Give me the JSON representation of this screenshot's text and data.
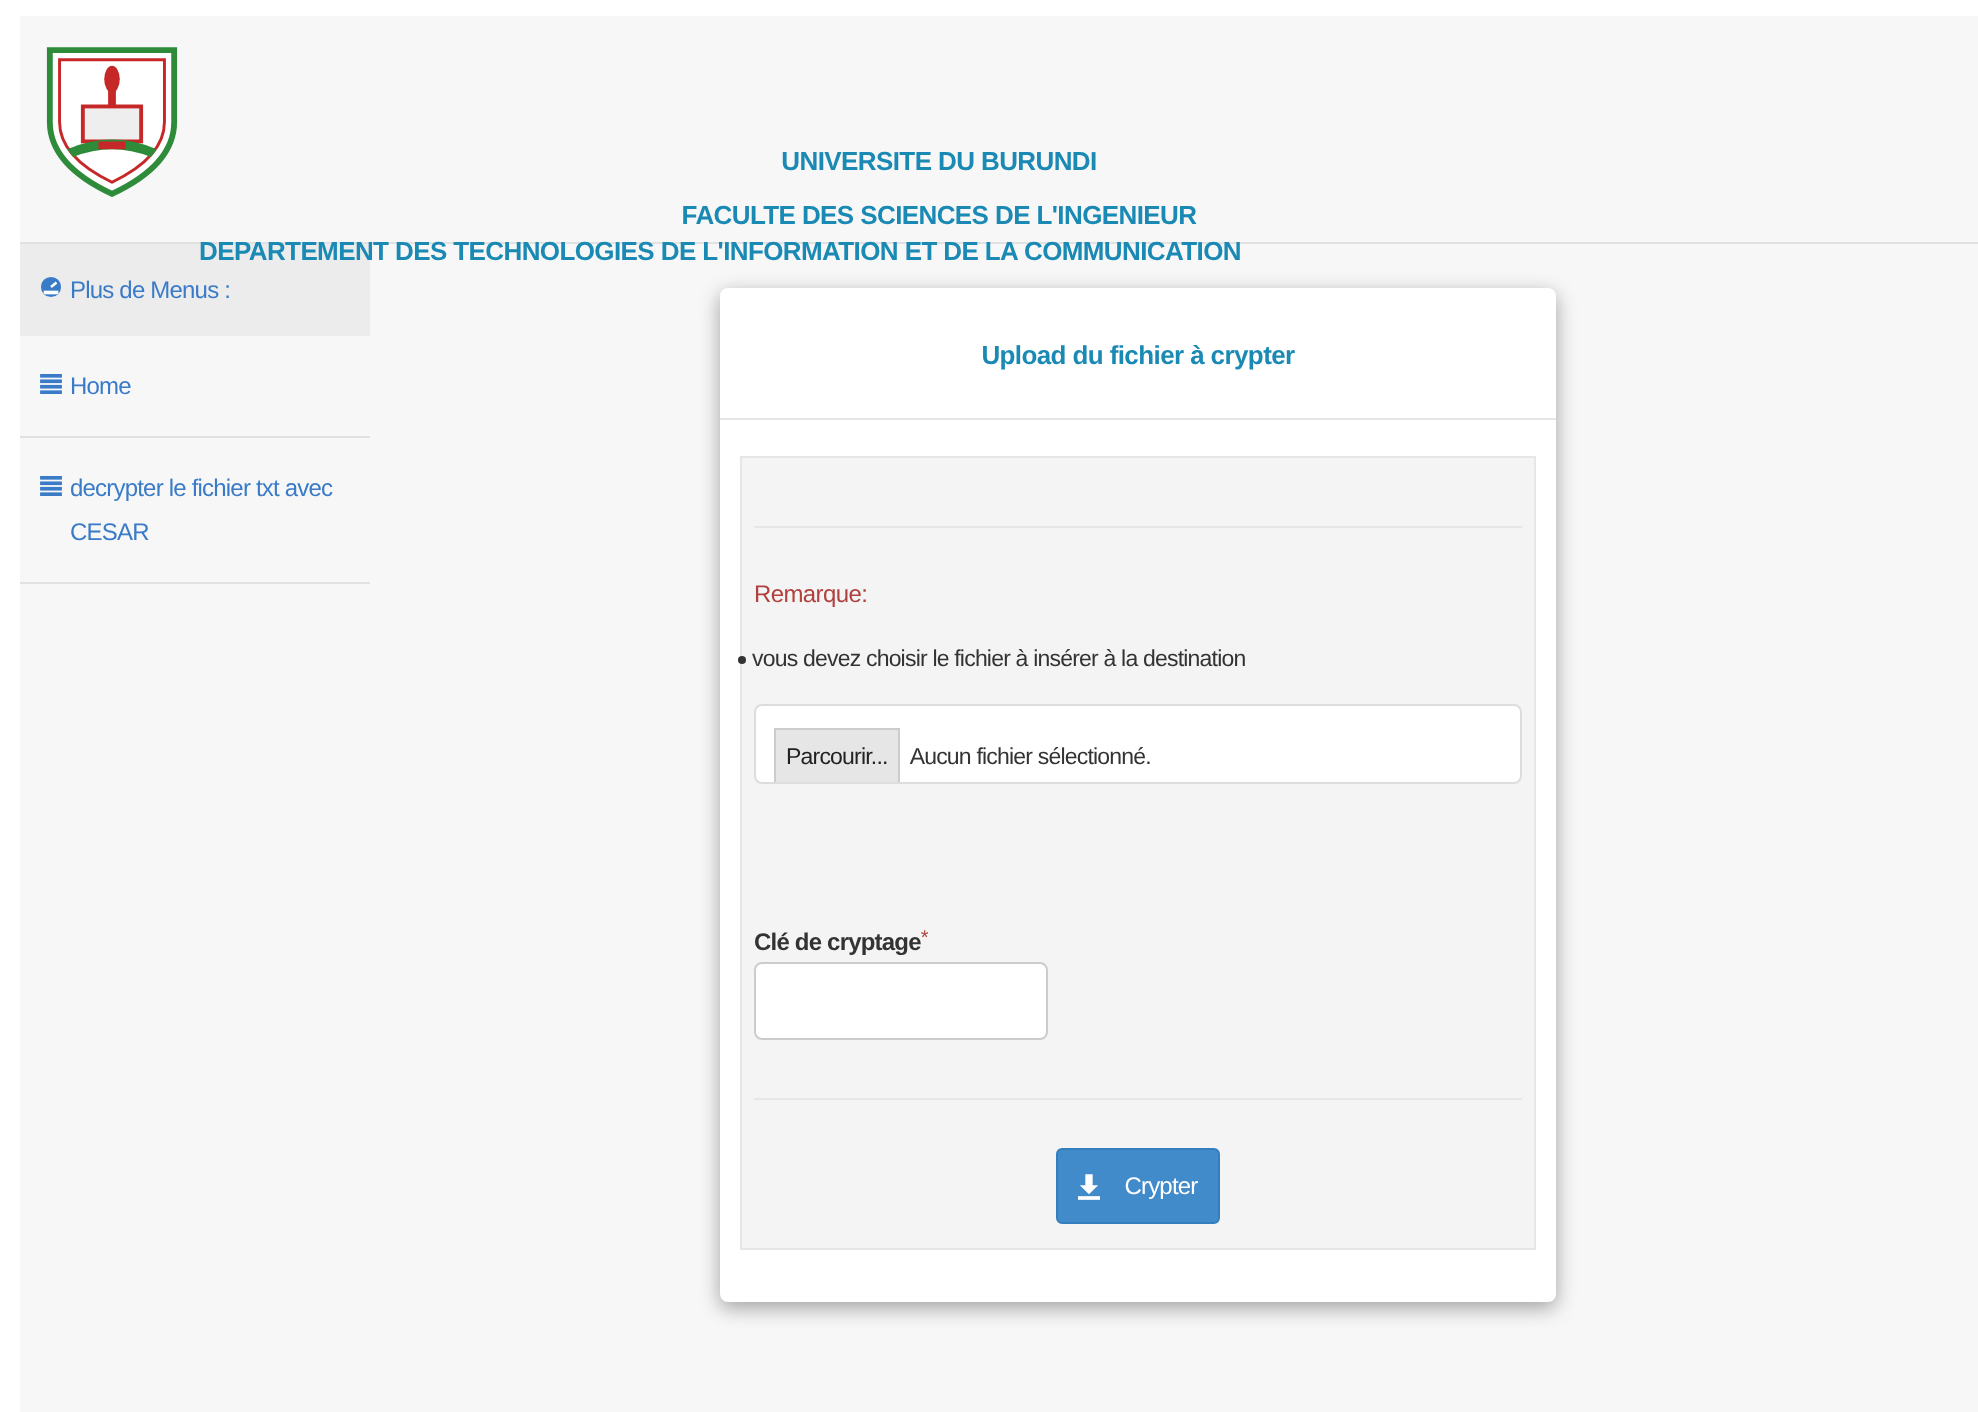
{
  "header": {
    "titles": [
      "UNIVERSITE DU BURUNDI",
      "FACULTE DES SCIENCES DE L'INGENIEUR",
      "DEPARTEMENT DES TECHNOLOGIES DE L'INFORMATION ET DE LA COMMUNICATION"
    ]
  },
  "sidebar": {
    "items": [
      {
        "label": "Plus de Menus :",
        "kind": "heading"
      },
      {
        "label": "Home",
        "kind": "link"
      },
      {
        "label": "decrypter le fichier txt avec CESAR",
        "kind": "link"
      }
    ]
  },
  "card": {
    "title": "Upload du fichier à crypter",
    "remark_label": "Remarque:",
    "bullets": [
      "vous devez choisir le fichier à insérer à la destination"
    ],
    "file_input": {
      "button": "Parcourir...",
      "status": "Aucun fichier sélectionné."
    },
    "key_field": {
      "label": "Clé de cryptage",
      "required_mark": "*"
    },
    "submit": "Crypter"
  }
}
